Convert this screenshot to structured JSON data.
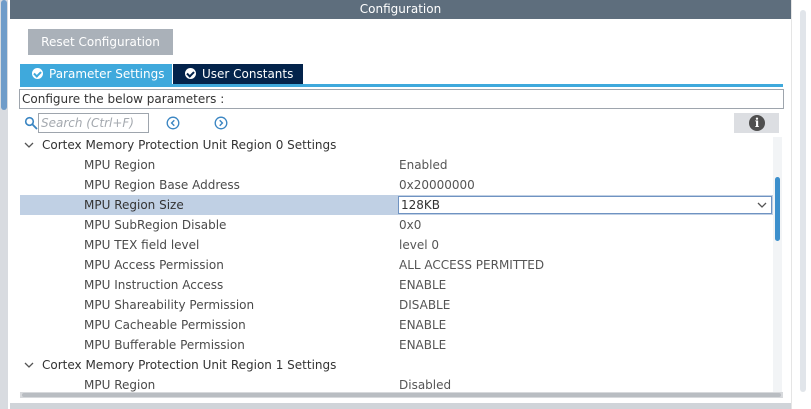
{
  "panel": {
    "title": "Configuration",
    "reset_button": "Reset Configuration"
  },
  "tabs": [
    {
      "label": "Parameter Settings",
      "icon": "check-circle-icon",
      "active": true
    },
    {
      "label": "User Constants",
      "icon": "check-circle-icon",
      "active": false
    }
  ],
  "config_label": "Configure the below parameters :",
  "search": {
    "placeholder": "Search (Ctrl+F)",
    "value": ""
  },
  "sections": [
    {
      "title": "Cortex Memory Protection Unit Region 0 Settings",
      "expanded": true,
      "params": [
        {
          "name": "MPU Region",
          "value": "Enabled"
        },
        {
          "name": "MPU Region Base Address",
          "value": "0x20000000"
        },
        {
          "name": "MPU Region Size",
          "value": "128KB",
          "selected": true
        },
        {
          "name": "MPU SubRegion Disable",
          "value": "0x0"
        },
        {
          "name": "MPU TEX field level",
          "value": "level 0"
        },
        {
          "name": "MPU Access Permission",
          "value": "ALL ACCESS PERMITTED"
        },
        {
          "name": "MPU Instruction Access",
          "value": "ENABLE"
        },
        {
          "name": "MPU Shareability Permission",
          "value": "DISABLE"
        },
        {
          "name": "MPU Cacheable Permission",
          "value": "ENABLE"
        },
        {
          "name": "MPU Bufferable  Permission",
          "value": "ENABLE"
        }
      ]
    },
    {
      "title": "Cortex Memory Protection Unit Region 1 Settings",
      "expanded": true,
      "params": [
        {
          "name": "MPU Region",
          "value": "Disabled"
        }
      ]
    }
  ],
  "colors": {
    "title_bar": "#5e6e7d",
    "tab_active": "#3fa9dc",
    "tab_inactive": "#03234b",
    "selected_row": "#c0d0e4",
    "scroll_thumb": "#3c8fcc"
  }
}
